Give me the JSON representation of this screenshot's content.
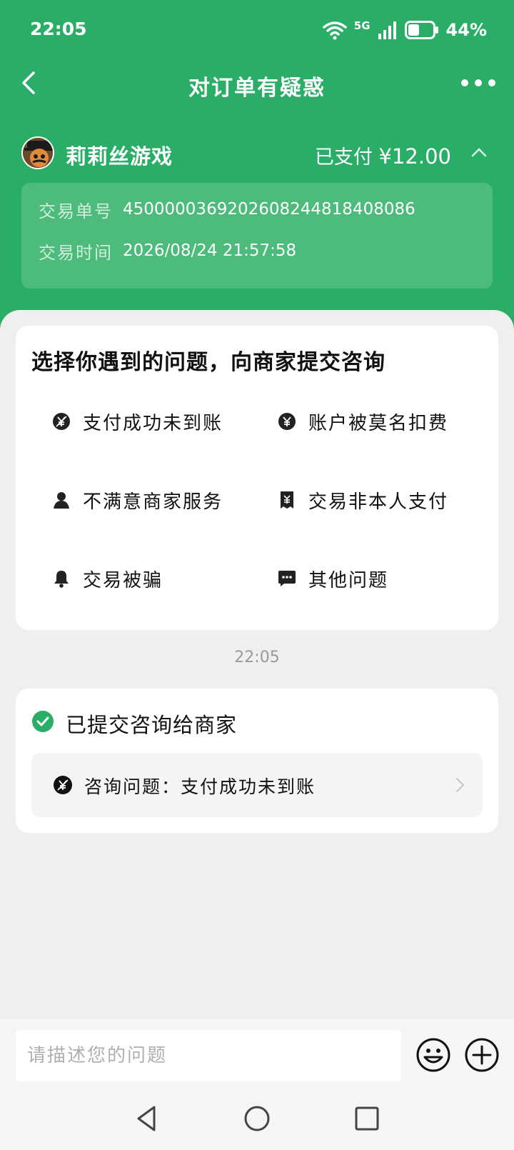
{
  "status_bar": {
    "time": "22:05",
    "network": "5G",
    "battery_percent": "44%",
    "battery_level": 0.44
  },
  "nav": {
    "title": "对订单有疑惑"
  },
  "merchant": {
    "name": "莉莉丝游戏",
    "paid_prefix": "已支付",
    "amount": "¥12.00"
  },
  "order": {
    "id_label": "交易单号",
    "id_value": "4500000369202608244818408086",
    "time_label": "交易时间",
    "time_value": "2026/08/24 21:57:58"
  },
  "issues": {
    "title": "选择你遇到的问题，向商家提交咨询",
    "items": [
      {
        "label": "支付成功未到账",
        "icon": "yen-slash-icon"
      },
      {
        "label": "账户被莫名扣费",
        "icon": "yen-circle-icon"
      },
      {
        "label": "不满意商家服务",
        "icon": "person-icon"
      },
      {
        "label": "交易非本人支付",
        "icon": "receipt-icon"
      },
      {
        "label": "交易被骗",
        "icon": "bell-icon"
      },
      {
        "label": "其他问题",
        "icon": "chat-bubble-icon"
      }
    ]
  },
  "chat": {
    "time": "22:05"
  },
  "submitted": {
    "title": "已提交咨询给商家",
    "consult_label": "咨询问题：支付成功未到账"
  },
  "input": {
    "placeholder": "请描述您的问题"
  },
  "colors": {
    "brand_green": "#2aae67",
    "detail_box": "#4cbb7b",
    "check_green": "#2aae67"
  }
}
